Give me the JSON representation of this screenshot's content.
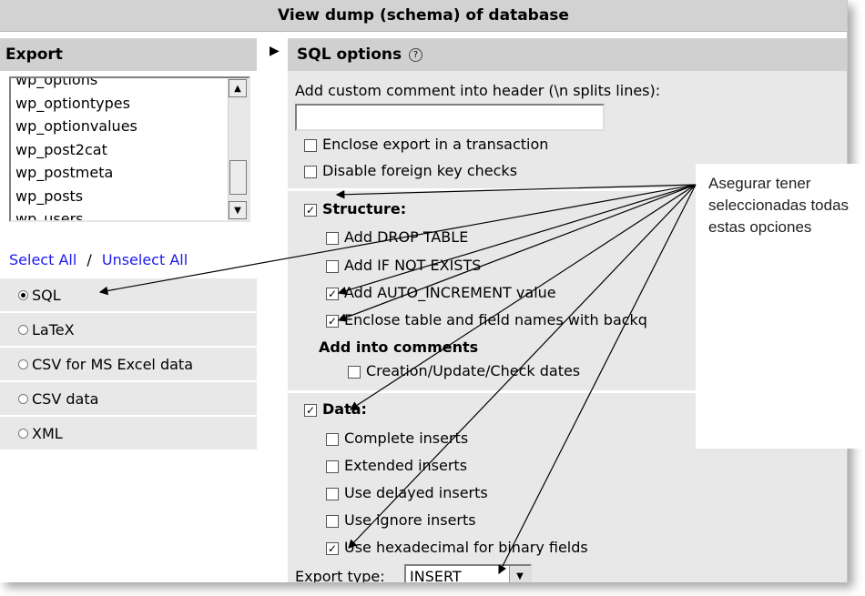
{
  "title": "View dump (schema) of database",
  "export_panel": {
    "header": "Export",
    "tables": [
      "wp_options",
      "wp_optiontypes",
      "wp_optionvalues",
      "wp_post2cat",
      "wp_postmeta",
      "wp_posts",
      "wp_users"
    ],
    "select_all": "Select All",
    "separator": "/",
    "unselect_all": "Unselect All",
    "formats": [
      {
        "label": "SQL",
        "selected": true
      },
      {
        "label": "LaTeX",
        "selected": false
      },
      {
        "label": "CSV for MS Excel data",
        "selected": false
      },
      {
        "label": "CSV data",
        "selected": false
      },
      {
        "label": "XML",
        "selected": false
      }
    ]
  },
  "sql_options": {
    "header": "SQL options",
    "help_icon": "?",
    "comment_label": "Add custom comment into header (\\n splits lines):",
    "comment_value": "",
    "enclose_transaction": "Enclose export in a transaction",
    "disable_fk": "Disable foreign key checks",
    "structure": "Structure:",
    "add_drop_table": "Add DROP TABLE",
    "add_if_not_exists": "Add IF NOT EXISTS",
    "add_auto_increment": "Add AUTO_INCREMENT value",
    "enclose_backquotes": "Enclose table and field names with backq",
    "add_into_comments": "Add into comments",
    "creation_dates": "Creation/Update/Check dates",
    "data": "Data:",
    "complete_inserts": "Complete inserts",
    "extended_inserts": "Extended inserts",
    "delayed_inserts": "Use delayed inserts",
    "ignore_inserts": "Use ignore inserts",
    "hex_binary": "Use hexadecimal for binary fields",
    "export_type_label": "Export type:",
    "export_type_value": "INSERT"
  },
  "callout": {
    "text": "Asegurar tener seleccionadas todas estas opciones"
  },
  "checked_mark": "✓",
  "colors": {
    "link": "#1a1aee",
    "panel": "#e8e8e8",
    "header": "#d0d0d0"
  }
}
